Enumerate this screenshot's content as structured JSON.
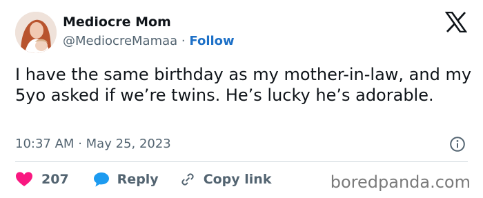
{
  "author": {
    "name": "Mediocre Mom",
    "handle": "@MediocreMamaa",
    "separator": "·",
    "follow_label": "Follow"
  },
  "tweet": {
    "text": "I have the same birthday as my mother-in-law, and my 5yo asked if we’re twins. He’s lucky he’s adorable.",
    "time": "10:37 AM",
    "meta_separator": "·",
    "date": "May 25, 2023"
  },
  "actions": {
    "like_count": "207",
    "reply_label": "Reply",
    "copy_label": "Copy link"
  },
  "watermark": "boredpanda.com",
  "icons": {
    "logo": "x-logo",
    "info": "info-icon",
    "like": "heart-icon",
    "reply": "speech-bubble-icon",
    "copy": "link-icon"
  },
  "colors": {
    "follow": "#1d70c7",
    "heart": "#f91880",
    "reply_bubble": "#1d9bf0",
    "muted_text": "#536471"
  }
}
